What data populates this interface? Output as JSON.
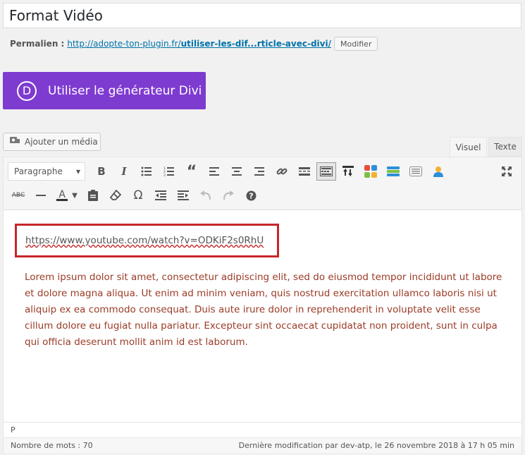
{
  "post": {
    "title": "Format Vidéo",
    "permalink_label": "Permalien :",
    "permalink_url_base": "http://adopte-ton-plugin.fr/",
    "permalink_url_slug": "utiliser-les-dif...rticle-avec-divi/",
    "modify_label": "Modifier"
  },
  "divi": {
    "logo_letter": "D",
    "label": "Utiliser le générateur Divi",
    "color": "#7e3bd0"
  },
  "media": {
    "label": "Ajouter un média",
    "icon": "camera-music-icon"
  },
  "tabs": {
    "visuel": "Visuel",
    "texte": "Texte"
  },
  "toolbar": {
    "format_select": "Paragraphe",
    "row1_icons": [
      "bold-icon",
      "italic-icon",
      "bulleted-list-icon",
      "numbered-list-icon",
      "blockquote-icon",
      "align-left-icon",
      "align-center-icon",
      "align-right-icon",
      "link-icon",
      "read-more-icon",
      "toolbar-toggle-icon",
      "insert-icon",
      "shortcode-grid-icon",
      "layout-icon",
      "page-icon",
      "user-icon"
    ],
    "row2_icons": [
      "strikethrough-icon",
      "horizontal-line-icon",
      "text-color-icon",
      "paste-text-icon",
      "clear-formatting-icon",
      "special-character-icon",
      "outdent-icon",
      "indent-icon",
      "undo-icon",
      "redo-icon",
      "help-icon"
    ]
  },
  "editor": {
    "video_url": "https://www.youtube.com/watch?v=ODKiF2s0RhU",
    "body": "Lorem ipsum dolor sit amet, consectetur adipiscing elit, sed do eiusmod tempor incididunt ut labore et dolore magna aliqua. Ut enim ad minim veniam, quis nostrud exercitation ullamco laboris nisi ut aliquip ex ea commodo consequat. Duis aute irure dolor in reprehenderit in voluptate velit esse cillum dolore eu fugiat nulla pariatur. Excepteur sint occaecat cupidatat non proident, sunt in culpa qui officia deserunt mollit anim id est laborum.",
    "path": "P",
    "word_count": "Nombre de mots : 70",
    "last_modified": "Dernière modification par dev-atp, le 26 novembre 2018 à 17 h 05 min",
    "highlight_color": "#c8262b"
  }
}
